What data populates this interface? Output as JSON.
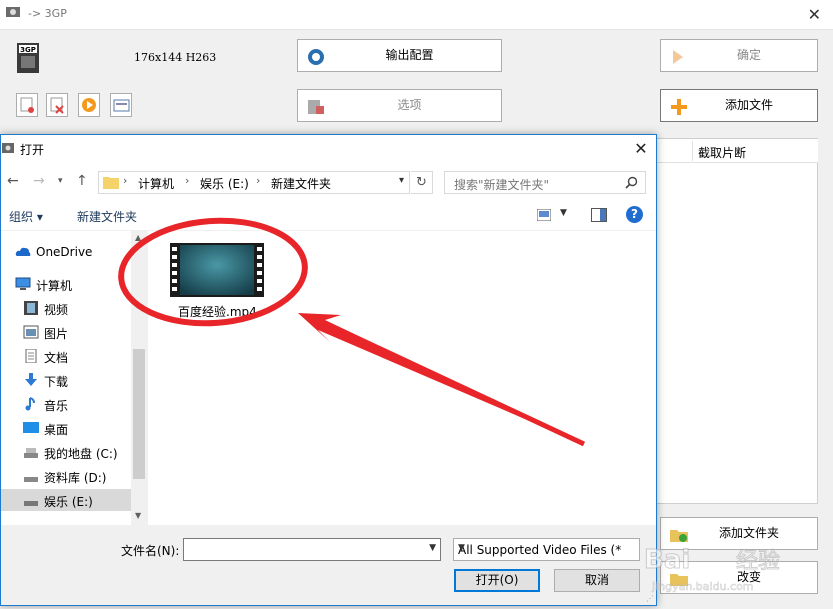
{
  "bg_window": {
    "title": "-> 3GP",
    "format_text": "176x144 H263",
    "output_config_label": "输出配置",
    "options_label": "选项",
    "confirm_label": "确定",
    "add_file_label": "添加文件",
    "add_folder_label": "添加文件夹",
    "change_label": "改变",
    "list_header": "截取片断"
  },
  "dialog": {
    "title": "打开",
    "breadcrumbs": [
      "计算机",
      "娱乐 (E:)",
      "新建文件夹"
    ],
    "search_placeholder": "搜索\"新建文件夹\"",
    "organize_label": "组织 ▾",
    "new_folder_label": "新建文件夹",
    "nav_items": [
      {
        "label": "OneDrive",
        "icon": "cloud-icon"
      },
      {
        "label": "计算机",
        "icon": "computer-icon"
      },
      {
        "label": "视频",
        "icon": "video-icon"
      },
      {
        "label": "图片",
        "icon": "picture-icon"
      },
      {
        "label": "文档",
        "icon": "document-icon"
      },
      {
        "label": "下载",
        "icon": "download-icon"
      },
      {
        "label": "音乐",
        "icon": "music-icon"
      },
      {
        "label": "桌面",
        "icon": "desktop-icon"
      },
      {
        "label": "我的地盘 (C:)",
        "icon": "drive-icon"
      },
      {
        "label": "资料库 (D:)",
        "icon": "drive-icon"
      },
      {
        "label": "娱乐 (E:)",
        "icon": "drive-icon",
        "selected": true
      }
    ],
    "file_name": "百度经验.mp4",
    "filename_label": "文件名(N):",
    "filename_value": "",
    "filter_value": "All Supported Video Files (*.",
    "open_label": "打开(O)",
    "cancel_label": "取消"
  },
  "colors": {
    "accent": "#0078d7",
    "annotation_red": "#e8262a",
    "dialog_border": "#1e7ad1"
  }
}
